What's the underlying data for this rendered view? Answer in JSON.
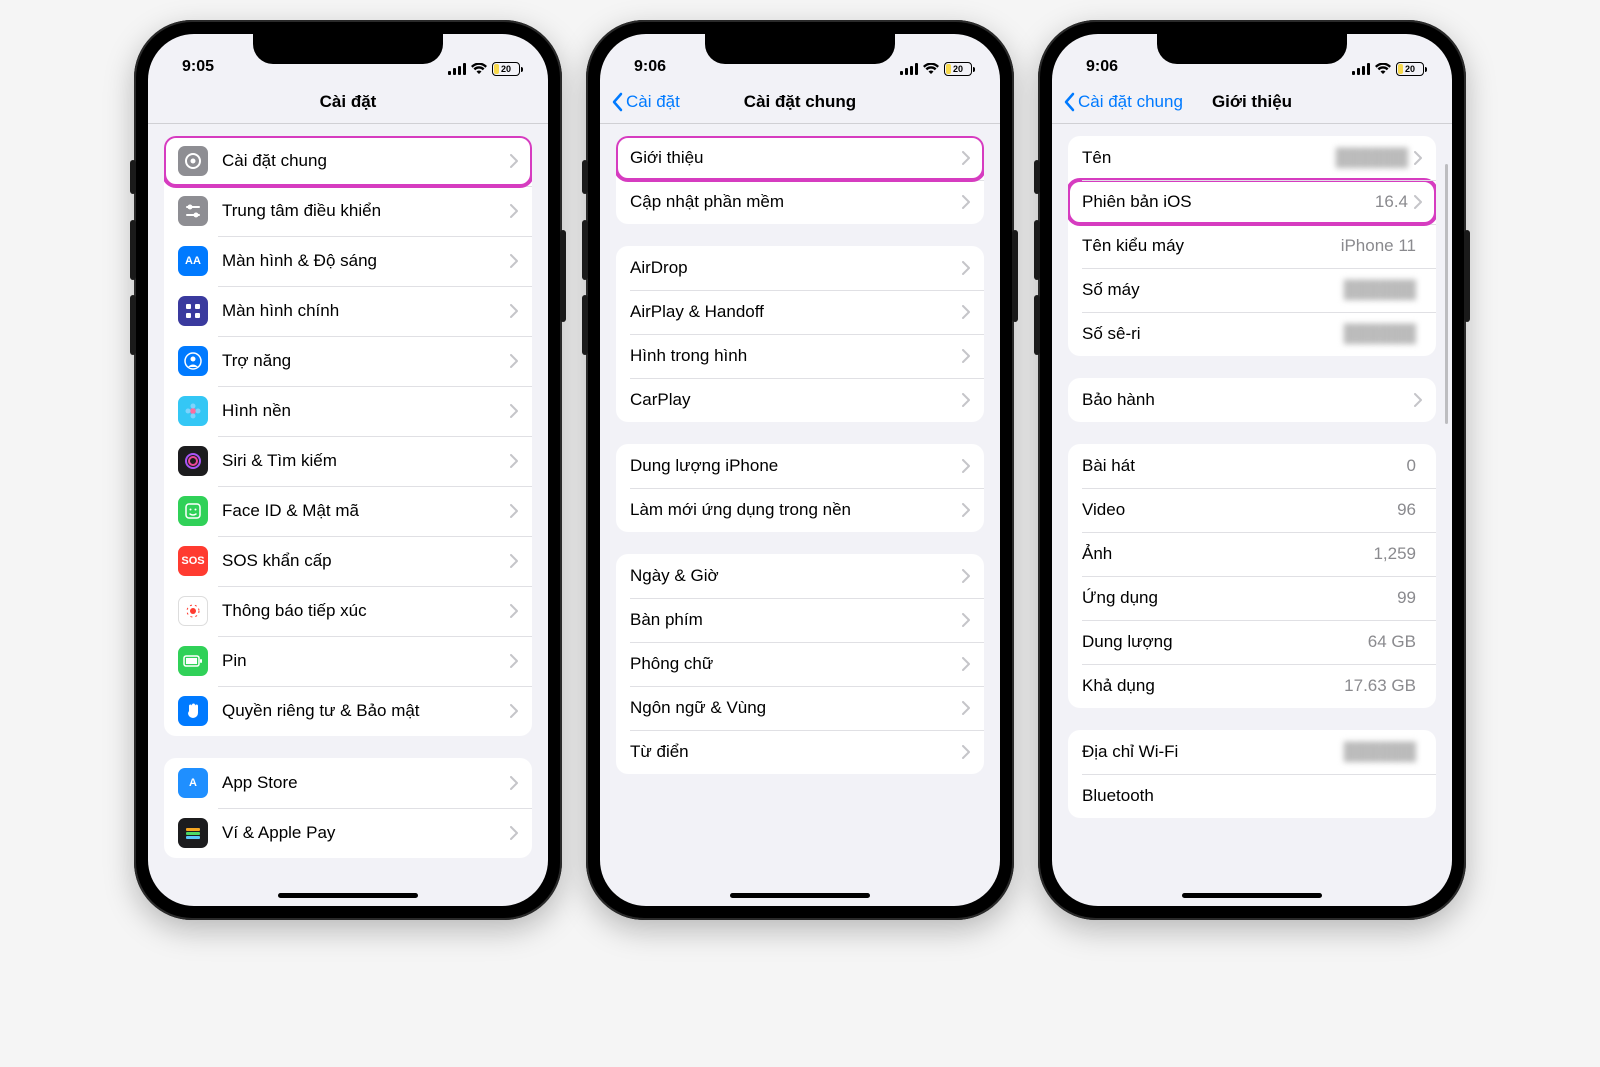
{
  "status": {
    "time1": "9:05",
    "time2": "9:06",
    "time3": "9:06",
    "battery": "20"
  },
  "phone1": {
    "title": "Cài đặt",
    "rows1": [
      {
        "id": "general",
        "label": "Cài đặt chung",
        "iconBg": "#8e8e93",
        "glyph": "gear",
        "highlight": true
      },
      {
        "id": "control-center",
        "label": "Trung tâm điều khiển",
        "iconBg": "#8e8e93",
        "glyph": "sliders"
      },
      {
        "id": "display",
        "label": "Màn hình & Độ sáng",
        "iconBg": "#007aff",
        "glyph": "AA"
      },
      {
        "id": "home-screen",
        "label": "Màn hình chính",
        "iconBg": "#3a3a9e",
        "glyph": "grid"
      },
      {
        "id": "accessibility",
        "label": "Trợ năng",
        "iconBg": "#007aff",
        "glyph": "person"
      },
      {
        "id": "wallpaper",
        "label": "Hình nền",
        "iconBg": "#34c7f5",
        "glyph": "flower"
      },
      {
        "id": "siri",
        "label": "Siri & Tìm kiếm",
        "iconBg": "#1c1c1e",
        "glyph": "siri"
      },
      {
        "id": "faceid",
        "label": "Face ID & Mật mã",
        "iconBg": "#30d158",
        "glyph": "face"
      },
      {
        "id": "sos",
        "label": "SOS khẩn cấp",
        "iconBg": "#ff3b30",
        "glyph": "SOS"
      },
      {
        "id": "exposure",
        "label": "Thông báo tiếp xúc",
        "iconBg": "#ffffff",
        "glyph": "exposure"
      },
      {
        "id": "battery",
        "label": "Pin",
        "iconBg": "#30d158",
        "glyph": "battery"
      },
      {
        "id": "privacy",
        "label": "Quyền riêng tư & Bảo mật",
        "iconBg": "#007aff",
        "glyph": "hand"
      }
    ],
    "rows2": [
      {
        "id": "appstore",
        "label": "App Store",
        "iconBg": "#1f8fff",
        "glyph": "A"
      },
      {
        "id": "wallet",
        "label": "Ví & Apple Pay",
        "iconBg": "#1c1c1e",
        "glyph": "wallet"
      }
    ]
  },
  "phone2": {
    "back": "Cài đặt",
    "title": "Cài đặt chung",
    "g1": [
      {
        "id": "about",
        "label": "Giới thiệu",
        "highlight": true
      },
      {
        "id": "update",
        "label": "Cập nhật phần mềm"
      }
    ],
    "g2": [
      {
        "id": "airdrop",
        "label": "AirDrop"
      },
      {
        "id": "airplay",
        "label": "AirPlay & Handoff"
      },
      {
        "id": "pip",
        "label": "Hình trong hình"
      },
      {
        "id": "carplay",
        "label": "CarPlay"
      }
    ],
    "g3": [
      {
        "id": "storage",
        "label": "Dung lượng iPhone"
      },
      {
        "id": "bgrefresh",
        "label": "Làm mới ứng dụng trong nền"
      }
    ],
    "g4": [
      {
        "id": "datetime",
        "label": "Ngày & Giờ"
      },
      {
        "id": "keyboard",
        "label": "Bàn phím"
      },
      {
        "id": "fonts",
        "label": "Phông chữ"
      },
      {
        "id": "language",
        "label": "Ngôn ngữ & Vùng"
      },
      {
        "id": "dictionary",
        "label": "Từ điển"
      }
    ]
  },
  "phone3": {
    "back": "Cài đặt chung",
    "title": "Giới thiệu",
    "g1": [
      {
        "id": "name",
        "label": "Tên",
        "value": "",
        "blur": true,
        "chev": true
      },
      {
        "id": "ios",
        "label": "Phiên bản iOS",
        "value": "16.4",
        "chev": true,
        "highlight": true
      },
      {
        "id": "model-name",
        "label": "Tên kiểu máy",
        "value": "iPhone 11"
      },
      {
        "id": "model-number",
        "label": "Số máy",
        "value": "",
        "blur": true
      },
      {
        "id": "serial",
        "label": "Số sê-ri",
        "value": "",
        "blur": true
      }
    ],
    "g2": [
      {
        "id": "warranty",
        "label": "Bảo hành",
        "chev": true
      }
    ],
    "g3": [
      {
        "id": "songs",
        "label": "Bài hát",
        "value": "0"
      },
      {
        "id": "videos",
        "label": "Video",
        "value": "96"
      },
      {
        "id": "photos",
        "label": "Ảnh",
        "value": "1,259"
      },
      {
        "id": "apps",
        "label": "Ứng dụng",
        "value": "99"
      },
      {
        "id": "capacity",
        "label": "Dung lượng",
        "value": "64 GB"
      },
      {
        "id": "available",
        "label": "Khả dụng",
        "value": "17.63 GB"
      }
    ],
    "g4": [
      {
        "id": "wifi-addr",
        "label": "Địa chỉ Wi-Fi",
        "value": "",
        "blur": true
      },
      {
        "id": "bluetooth",
        "label": "Bluetooth",
        "value": ""
      }
    ]
  }
}
